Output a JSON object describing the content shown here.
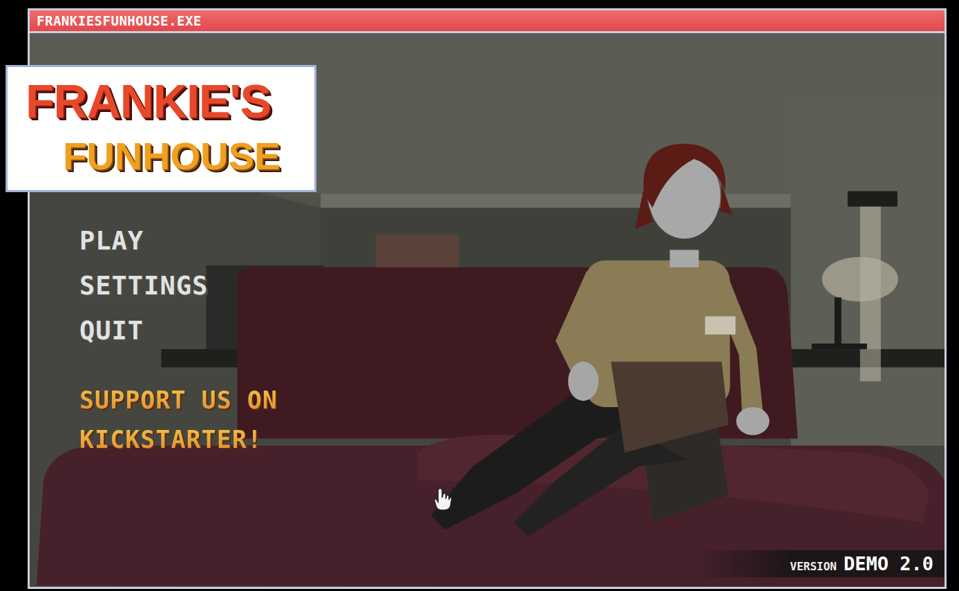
{
  "window": {
    "title": "FRANKIESFUNHOUSE.EXE"
  },
  "logo": {
    "lines": [
      "FRANKIE'S",
      "FUNHOUSE"
    ]
  },
  "menu": {
    "items": [
      {
        "label": "PLAY"
      },
      {
        "label": "SETTINGS"
      },
      {
        "label": "QUIT"
      }
    ]
  },
  "promo": {
    "lines": [
      "SUPPORT US ON",
      "KICKSTARTER!"
    ]
  },
  "version": {
    "label": "VERSION",
    "value": "DEMO 2.0"
  }
}
